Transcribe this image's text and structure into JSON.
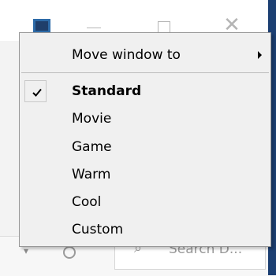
{
  "background_window": {
    "search_placeholder": "Search D..."
  },
  "menu": {
    "move_window_label": "Move window to",
    "options": [
      {
        "label": "Standard",
        "checked": true
      },
      {
        "label": "Movie",
        "checked": false
      },
      {
        "label": "Game",
        "checked": false
      },
      {
        "label": "Warm",
        "checked": false
      },
      {
        "label": "Cool",
        "checked": false
      },
      {
        "label": "Custom",
        "checked": false
      }
    ]
  },
  "icons": {
    "app": "app-icon",
    "minimize": "minimize-icon",
    "maximize": "maximize-icon",
    "close": "close-icon",
    "submenu": "chevron-right-icon",
    "check": "checkmark-icon",
    "refresh": "refresh-icon",
    "search": "search-icon",
    "dropdown": "chevron-down-icon"
  },
  "colors": {
    "menu_background": "#f0f0f0",
    "menu_border": "#979797",
    "window_edge": "#1c3f72"
  }
}
